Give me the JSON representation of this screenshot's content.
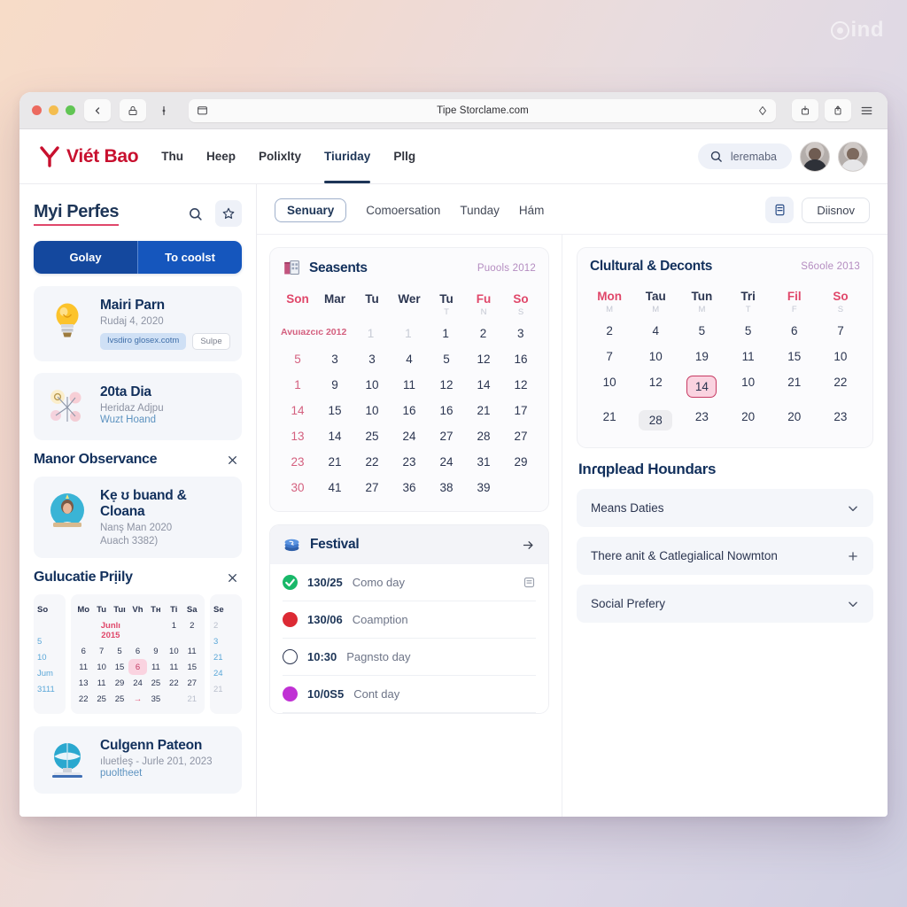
{
  "watermark": {
    "text": "ind"
  },
  "browser": {
    "url": "Tipe Storclame.com",
    "back_icon": "chevron-left-icon",
    "lock_icon": "lock-icon",
    "more_icon": "more-vertical-icon",
    "sidebar_icon": "sidebar-icon",
    "reader_icon": "reader-toggle-icon",
    "download_icon": "download-icon",
    "share_icon": "share-icon",
    "menu_icon": "hamburger-menu-icon"
  },
  "site_header": {
    "brand": "Viét Bao",
    "nav": [
      {
        "label": "Thu",
        "active": false
      },
      {
        "label": "Heep",
        "active": false
      },
      {
        "label": "Polixlty",
        "active": false
      },
      {
        "label": "Tiuriday",
        "active": true
      },
      {
        "label": "Pllg",
        "active": false
      }
    ],
    "search_label": "leremaba"
  },
  "sidebar": {
    "title": "Myi Perfes",
    "search_icon": "search-icon",
    "star_icon": "star-icon",
    "segments": [
      "Golay",
      "To coolst"
    ],
    "cards": [
      {
        "title": "Mairi Parn",
        "sub": "Rudaj 4, 2020",
        "icon": "lightbulb-icon",
        "chips": [
          "Ivsdiro glosex.cotm",
          "Sulpe"
        ]
      },
      {
        "title": "20ta Dia",
        "sub": "Heridaz Adjpu",
        "sub2": "Wuzt Hoand",
        "icon": "network-diagram-icon"
      }
    ],
    "section_observance": {
      "title": "Manor Observance",
      "close_icon": "close-icon",
      "card": {
        "title": "Kẹ ʊ buand & Cloana",
        "sub": "Nanş Man 2020",
        "sub2": "Auach 3382)",
        "icon": "person-avatar-icon"
      }
    },
    "section_policy": {
      "title": "Gulucatie Prịily",
      "close_icon": "close-icon"
    },
    "mini_calendar": {
      "left_header": "So",
      "right_header": "Se",
      "mid_headers": [
        "Mo",
        "Tu",
        "Tuı",
        "Vh",
        "Tн",
        "Ti",
        "Sa"
      ],
      "month_label": "Junlı 2015",
      "left_col": [
        "5",
        "10",
        "Jum",
        "3111"
      ],
      "right_col": [
        "2",
        "3",
        "21",
        "24",
        "21"
      ],
      "mid_rows": [
        [
          "",
          "",
          "",
          "",
          "",
          "1",
          "2"
        ],
        [
          "6",
          "7",
          "5",
          "6",
          "9",
          "10",
          "11"
        ],
        [
          "11",
          "10",
          "15",
          "6",
          "11",
          "11",
          "15"
        ],
        [
          "13",
          "11",
          "29",
          "24",
          "25",
          "22",
          "27"
        ],
        [
          "22",
          "25",
          "25",
          "→",
          "35",
          "",
          "21"
        ]
      ],
      "selected": "6"
    },
    "bottom_card": {
      "title": "Culgenn Pateon",
      "sub": "ıluetİeş - Jurle 201, 2023",
      "sub2": "puoltheet",
      "icon": "globe-icon"
    }
  },
  "main": {
    "tabs": [
      {
        "label": "Senuary",
        "active": true
      },
      {
        "label": "Comoersation",
        "active": false
      },
      {
        "label": "Tunday",
        "active": false
      },
      {
        "label": "Hám",
        "active": false
      }
    ],
    "view_icon": "calendar-view-icon",
    "action_button": "Diisnov",
    "season_panel": {
      "title": "Seasents",
      "icon": "buildings-icon",
      "meta": "Puools 2012",
      "weekdays": [
        {
          "label": "Son",
          "tone": "pink"
        },
        {
          "label": "Mar",
          "tone": "dark"
        },
        {
          "label": "Tu",
          "tone": "dark"
        },
        {
          "label": "Wer",
          "tone": "dark"
        },
        {
          "label": "Tu",
          "tone": "dark"
        },
        {
          "label": "Fu",
          "tone": "pink"
        },
        {
          "label": "So",
          "tone": "pink"
        }
      ],
      "sub_letters": [
        "",
        "",
        "",
        "",
        "T",
        "N",
        "S"
      ],
      "month_inline_label": "Avuıazcıc 2012",
      "rows": [
        [
          "",
          "1",
          "1",
          "1",
          "2",
          "3"
        ],
        [
          "5",
          "3",
          "3",
          "4",
          "5",
          "12",
          "16"
        ],
        [
          "1",
          "9",
          "10",
          "11",
          "12",
          "14",
          "12"
        ],
        [
          "14",
          "15",
          "10",
          "16",
          "16",
          "21",
          "17"
        ],
        [
          "13",
          "14",
          "25",
          "24",
          "27",
          "28",
          "27"
        ],
        [
          "23",
          "21",
          "22",
          "23",
          "24",
          "31",
          "29"
        ],
        [
          "30",
          "41",
          "27",
          "36",
          "38",
          "39",
          ""
        ]
      ]
    },
    "festival_panel": {
      "title": "Festival",
      "icon": "layers-icon",
      "arrow_icon": "arrow-right-icon",
      "items": [
        {
          "time": "130/25",
          "label": "Como day",
          "dot": "green-check",
          "trailing_icon": "note-icon"
        },
        {
          "time": "130/06",
          "label": "Coamption",
          "dot": "red"
        },
        {
          "time": "10:30",
          "label": "Pagnsto day",
          "dot": "ring"
        },
        {
          "time": "10/0S5",
          "label": "Cont day",
          "dot": "purple"
        }
      ]
    },
    "cultural_panel": {
      "title": "Clultural & Deconts",
      "meta": "S6oole 2013",
      "weekdays": [
        {
          "label": "Mon",
          "tone": "pink"
        },
        {
          "label": "Tau",
          "tone": "dark"
        },
        {
          "label": "Tun",
          "tone": "dark"
        },
        {
          "label": "Tri",
          "tone": "dark"
        },
        {
          "label": "Fil",
          "tone": "pink"
        },
        {
          "label": "So",
          "tone": "pink"
        }
      ],
      "sub_letters": [
        "M",
        "M",
        "M",
        "T",
        "F",
        "S"
      ],
      "rows": [
        [
          "2",
          "4",
          "5",
          "5",
          "6",
          "7"
        ],
        [
          "7",
          "10",
          "19",
          "11",
          "15",
          "10"
        ],
        [
          "10",
          "12",
          "14",
          "10",
          "21",
          "22"
        ],
        [
          "21",
          "28",
          "23",
          "20",
          "20",
          "23"
        ]
      ],
      "selected": "14",
      "shaded": "28"
    },
    "accordion": {
      "title": "Inɾqplead Houndars",
      "items": [
        {
          "label": "Means Daties",
          "sign": "chevron-down-icon"
        },
        {
          "label": "There anit & Catlegialical Nowmton",
          "sign": "plus-icon"
        },
        {
          "label": "Social Prefery",
          "sign": "chevron-down-icon"
        }
      ]
    }
  }
}
